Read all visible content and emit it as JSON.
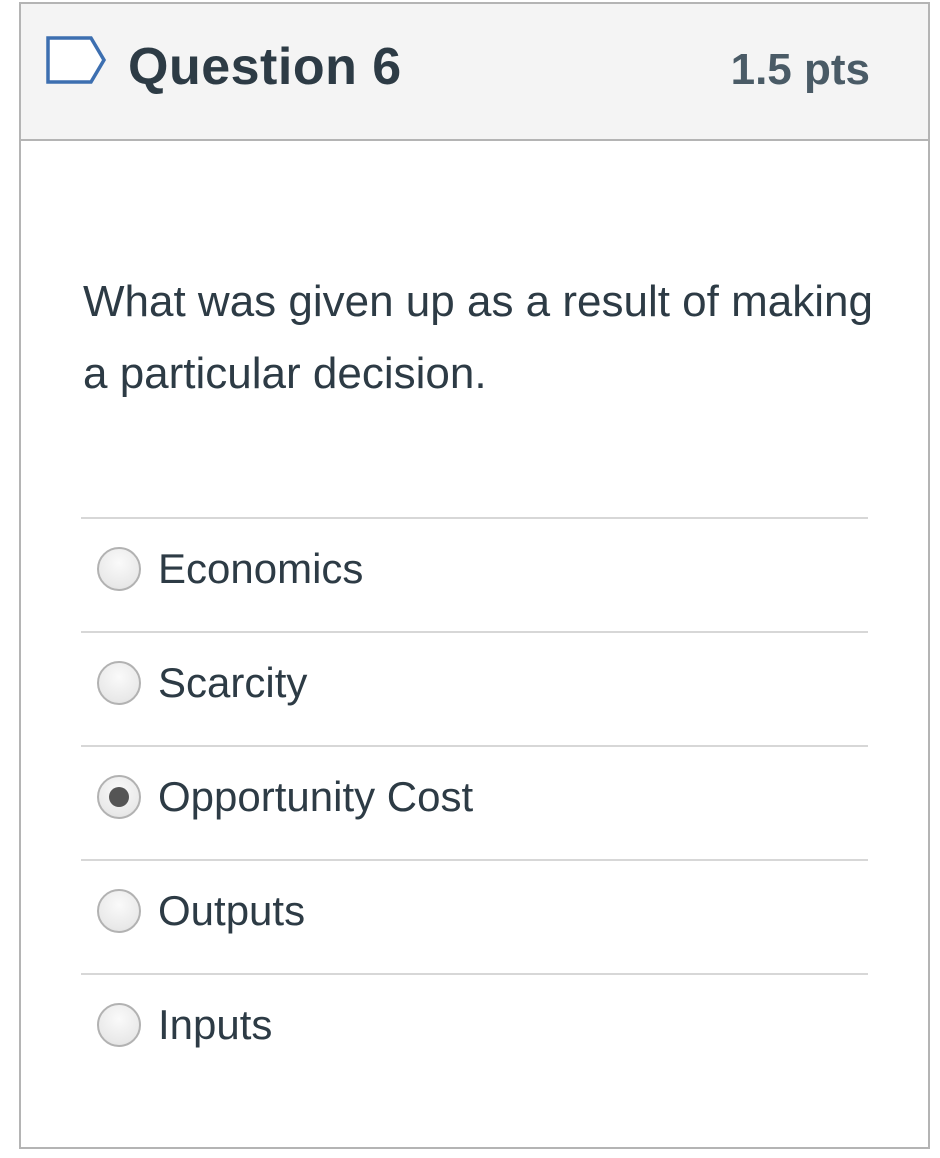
{
  "question": {
    "title": "Question 6",
    "points": "1.5 pts",
    "text": "What was given up as a result of making a particular decision.",
    "flag_icon": "flag-outline-icon"
  },
  "answers": [
    {
      "label": "Economics",
      "selected": false
    },
    {
      "label": "Scarcity",
      "selected": false
    },
    {
      "label": "Opportunity Cost",
      "selected": true
    },
    {
      "label": "Outputs",
      "selected": false
    },
    {
      "label": "Inputs",
      "selected": false
    }
  ],
  "colors": {
    "text": "#2d3b45",
    "header_bg": "#f4f4f4",
    "border": "#b4b4b4",
    "flag": "#3d6fb0"
  }
}
